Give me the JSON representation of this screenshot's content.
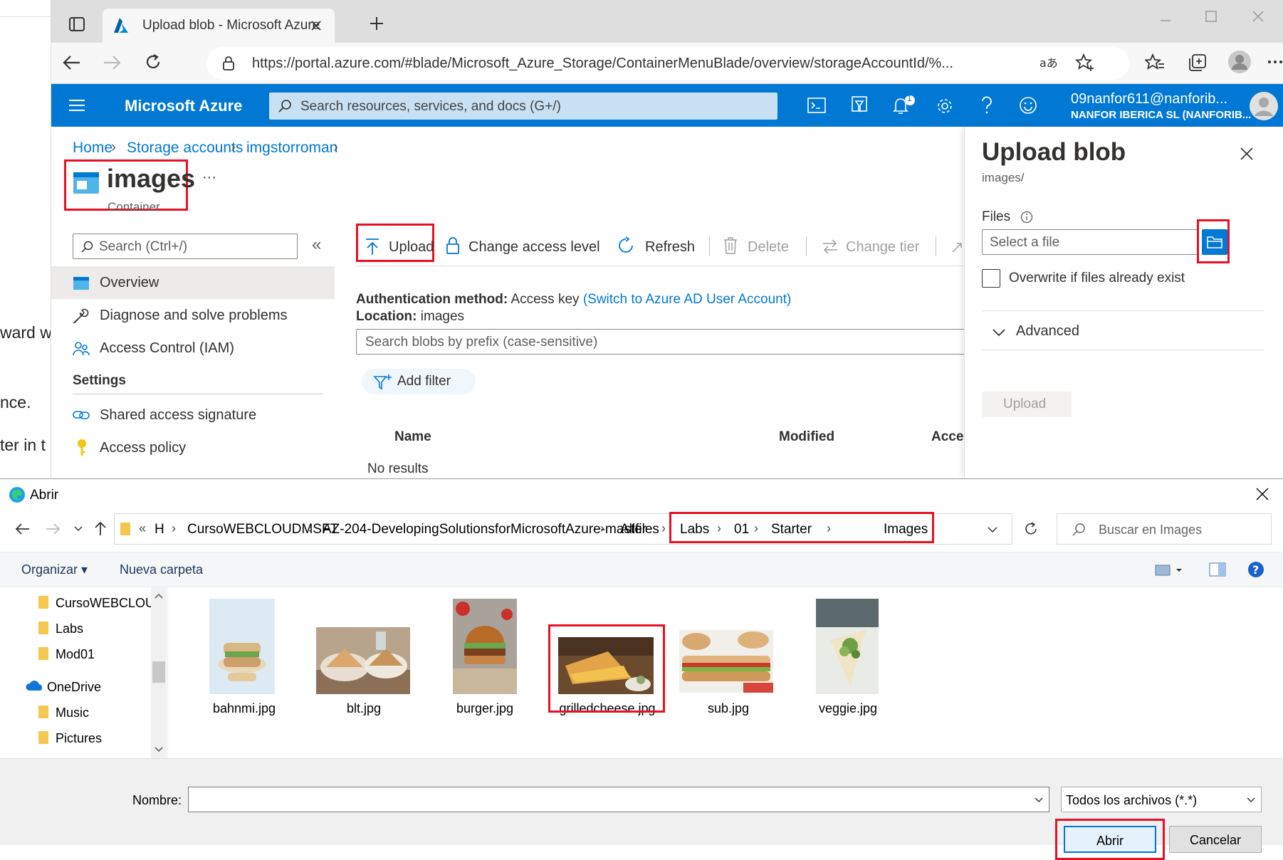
{
  "doc_sliver": {
    "lines": [
      "ward w",
      "nce.",
      "ter in t"
    ]
  },
  "browser": {
    "tab_title": "Upload blob - Microsoft Azure",
    "url": "https://portal.azure.com/#blade/Microsoft_Azure_Storage/ContainerMenuBlade/overview/storageAccountId/%..."
  },
  "azure": {
    "brand": "Microsoft Azure",
    "search_placeholder": "Search resources, services, and docs (G+/)",
    "notification_count": "1",
    "account_email": "09nanfor611@nanforib...",
    "account_org": "NANFOR IBERICA SL (NANFORIB..."
  },
  "breadcrumb": [
    "Home",
    "Storage accounts",
    "imgstorroman"
  ],
  "container": {
    "title": "images",
    "subtitle": "Container",
    "more": "···"
  },
  "sidebar": {
    "search_placeholder": "Search (Ctrl+/)",
    "collapse": "«",
    "items": [
      {
        "label": "Overview"
      },
      {
        "label": "Diagnose and solve problems"
      },
      {
        "label": "Access Control (IAM)"
      }
    ],
    "settings_header": "Settings",
    "settings_items": [
      {
        "label": "Shared access signature"
      },
      {
        "label": "Access policy"
      }
    ]
  },
  "toolbar": {
    "upload": "Upload",
    "change_access": "Change access level",
    "refresh": "Refresh",
    "delete": "Delete",
    "change_tier": "Change tier"
  },
  "overview": {
    "auth_label": "Authentication method:",
    "auth_value": "Access key",
    "auth_link": "(Switch to Azure AD User Account)",
    "location_label": "Location:",
    "location_value": "images",
    "blob_search_placeholder": "Search blobs by prefix (case-sensitive)",
    "add_filter": "Add filter",
    "columns": [
      "Name",
      "Modified",
      "Acces"
    ],
    "no_results": "No results"
  },
  "upload_panel": {
    "title": "Upload blob",
    "subtitle": "images/",
    "files_label": "Files",
    "file_placeholder": "Select a file",
    "overwrite_label": "Overwrite if files already exist",
    "advanced_label": "Advanced",
    "upload_button": "Upload"
  },
  "dialog": {
    "title": "Abrir",
    "path_prefix": "«",
    "path": [
      "H",
      "CursoWEBCLOUDMSFT",
      "AZ-204-DevelopingSolutionsforMicrosoftAzure-master",
      "Allfiles",
      "Labs",
      "01",
      "Starter",
      "Images"
    ],
    "search_placeholder": "Buscar en Images",
    "organize": "Organizar",
    "new_folder": "Nueva carpeta",
    "nav": [
      "CursoWEBCLOUI",
      "Labs",
      "Mod01",
      "OneDrive",
      "Music",
      "Pictures"
    ],
    "files": [
      "bahnmi.jpg",
      "blt.jpg",
      "burger.jpg",
      "grilledcheese.jpg",
      "sub.jpg",
      "veggie.jpg"
    ],
    "name_label": "Nombre:",
    "file_type": "Todos los archivos (*.*)",
    "open_button": "Abrir",
    "cancel_button": "Cancelar"
  },
  "colors": {
    "azure_blue": "#0078d4",
    "highlight_red": "#e81123"
  }
}
